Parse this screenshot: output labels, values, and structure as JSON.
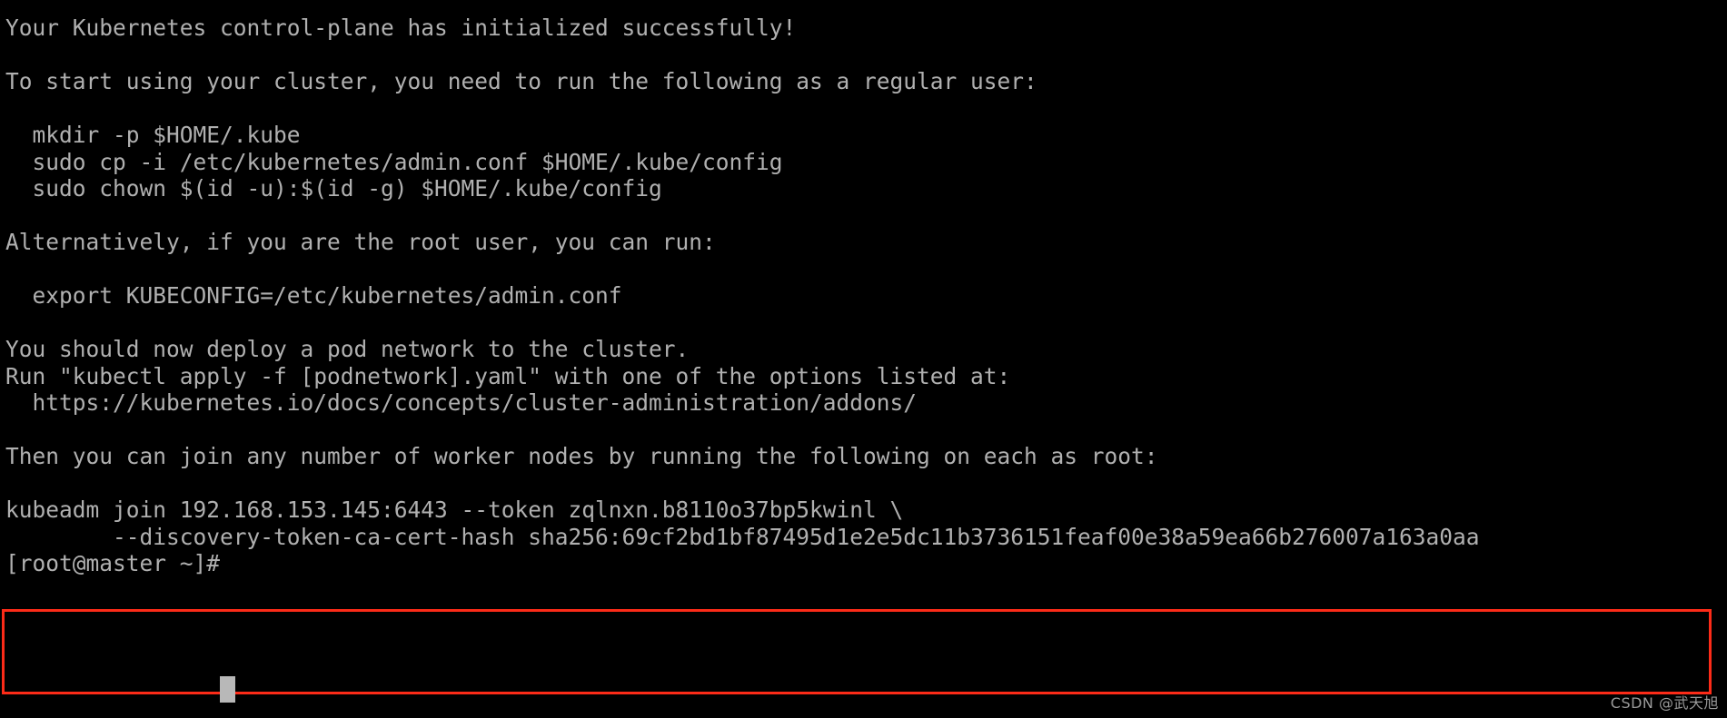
{
  "terminal": {
    "background_color": "#000000",
    "foreground_color": "#b0b0b0",
    "cursor_color": "#b8b8b8",
    "highlight_box_color": "#fc2b18",
    "prompt": "[root@master ~]#",
    "lines": [
      "Your Kubernetes control-plane has initialized successfully!",
      "",
      "To start using your cluster, you need to run the following as a regular user:",
      "",
      "  mkdir -p $HOME/.kube",
      "  sudo cp -i /etc/kubernetes/admin.conf $HOME/.kube/config",
      "  sudo chown $(id -u):$(id -g) $HOME/.kube/config",
      "",
      "Alternatively, if you are the root user, you can run:",
      "",
      "  export KUBECONFIG=/etc/kubernetes/admin.conf",
      "",
      "You should now deploy a pod network to the cluster.",
      "Run \"kubectl apply -f [podnetwork].yaml\" with one of the options listed at:",
      "  https://kubernetes.io/docs/concepts/cluster-administration/addons/",
      "",
      "Then you can join any number of worker nodes by running the following on each as root:",
      "",
      "kubeadm join 192.168.153.145:6443 --token zqlnxn.b8110o37bp5kwinl \\",
      "        --discovery-token-ca-cert-hash sha256:69cf2bd1bf87495d1e2e5dc11b3736151feaf00e38a59ea66b276007a163a0aa",
      "[root@master ~]# "
    ],
    "join_command": {
      "command": "kubeadm join",
      "api_server": "192.168.153.145:6443",
      "token_flag": "--token",
      "token": "zqlnxn.b8110o37bp5kwinl",
      "hash_flag": "--discovery-token-ca-cert-hash",
      "hash": "sha256:69cf2bd1bf87495d1e2e5dc11b3736151feaf00e38a59ea66b276007a163a0aa"
    }
  },
  "watermark": {
    "text": "CSDN @武天旭"
  }
}
